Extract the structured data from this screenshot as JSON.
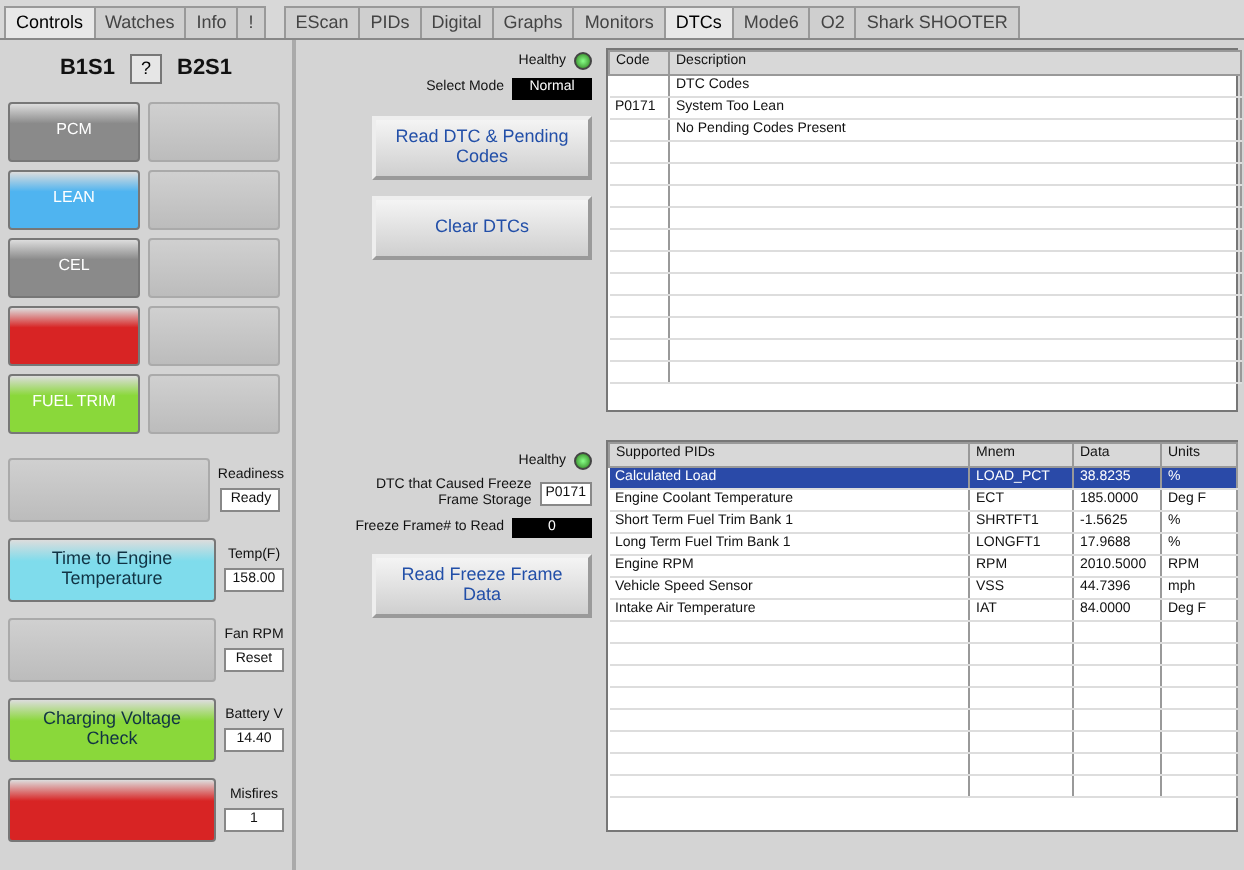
{
  "left_tabs": [
    {
      "label": "Controls",
      "selected": true
    },
    {
      "label": "Watches",
      "selected": false
    },
    {
      "label": "Info",
      "selected": false
    },
    {
      "label": "!",
      "selected": false
    }
  ],
  "right_tabs": [
    {
      "label": "EScan",
      "selected": false
    },
    {
      "label": "PIDs",
      "selected": false
    },
    {
      "label": "Digital",
      "selected": false
    },
    {
      "label": "Graphs",
      "selected": false
    },
    {
      "label": "Monitors",
      "selected": false
    },
    {
      "label": "DTCs",
      "selected": true
    },
    {
      "label": "Mode6",
      "selected": false
    },
    {
      "label": "O2",
      "selected": false
    },
    {
      "label": "Shark SHOOTER",
      "selected": false
    }
  ],
  "sensor_header": {
    "left": "B1S1",
    "help": "?",
    "right": "B2S1"
  },
  "status_buttons": [
    {
      "label": "PCM",
      "color": "#8a8a8a",
      "disabled": false
    },
    {
      "disabled": true
    },
    {
      "label": "LEAN",
      "color": "#4fb4f0",
      "disabled": false
    },
    {
      "disabled": true
    },
    {
      "label": "CEL",
      "color": "#8a8a8a",
      "disabled": false
    },
    {
      "disabled": true
    },
    {
      "color": "#d82424",
      "disabled": false
    },
    {
      "disabled": true
    },
    {
      "label": "FUEL TRIM",
      "color": "#8ad83a",
      "disabled": false
    },
    {
      "disabled": true
    }
  ],
  "test_buttons": [
    {
      "disabled": true,
      "readout_label": "Readiness",
      "readout": "Ready"
    },
    {
      "label": "Time to Engine Temperature",
      "color": "#7fdcec",
      "disabled": false,
      "readout_label": "Temp(F)",
      "readout": "158.00"
    },
    {
      "disabled": true,
      "readout_label": "Fan RPM",
      "readout": "Reset"
    },
    {
      "label": "Charging Voltage Check",
      "color": "#8ad83a",
      "disabled": false,
      "readout_label": "Battery V",
      "readout": "14.40"
    },
    {
      "color": "#d82424",
      "disabled": false,
      "readout_label": "Misfires",
      "readout": "1"
    }
  ],
  "dtc_panel": {
    "status_label": "Healthy",
    "status_on": true,
    "mode_label": "Select Mode",
    "mode_value": "Normal",
    "buttons": [
      "Read DTC & Pending Codes",
      "Clear DTCs"
    ]
  },
  "freeze_panel": {
    "status_label": "Healthy",
    "status_on": true,
    "dtc_label": "DTC that Caused Freeze Frame Storage",
    "dtc_value": "P0171",
    "frame_label": "Freeze Frame# to Read",
    "frame_value": "0",
    "button": "Read Freeze Frame Data"
  },
  "dtc_table": {
    "columns": [
      "Code",
      "Description"
    ],
    "rows": [
      [
        "",
        "DTC Codes"
      ],
      [
        "P0171",
        "System Too Lean"
      ],
      [
        "",
        "No Pending Codes Present"
      ]
    ]
  },
  "freeze_table": {
    "columns": [
      "Supported PIDs",
      "Mnem",
      "Data",
      "Units"
    ],
    "rows": [
      {
        "cells": [
          "Calculated Load",
          "LOAD_PCT",
          "38.8235",
          "%"
        ],
        "selected": true
      },
      {
        "cells": [
          "Engine Coolant Temperature",
          "ECT",
          "185.0000",
          "Deg F"
        ],
        "selected": false
      },
      {
        "cells": [
          "Short Term Fuel Trim Bank 1",
          "SHRTFT1",
          "-1.5625",
          "%"
        ],
        "selected": false
      },
      {
        "cells": [
          "Long Term Fuel Trim Bank 1",
          "LONGFT1",
          "17.9688",
          "%"
        ],
        "selected": false
      },
      {
        "cells": [
          "Engine RPM",
          "RPM",
          "2010.5000",
          "RPM"
        ],
        "selected": false
      },
      {
        "cells": [
          "Vehicle Speed Sensor",
          "VSS",
          "44.7396",
          "mph"
        ],
        "selected": false
      },
      {
        "cells": [
          "Intake Air Temperature",
          "IAT",
          "84.0000",
          "Deg F"
        ],
        "selected": false
      }
    ]
  }
}
